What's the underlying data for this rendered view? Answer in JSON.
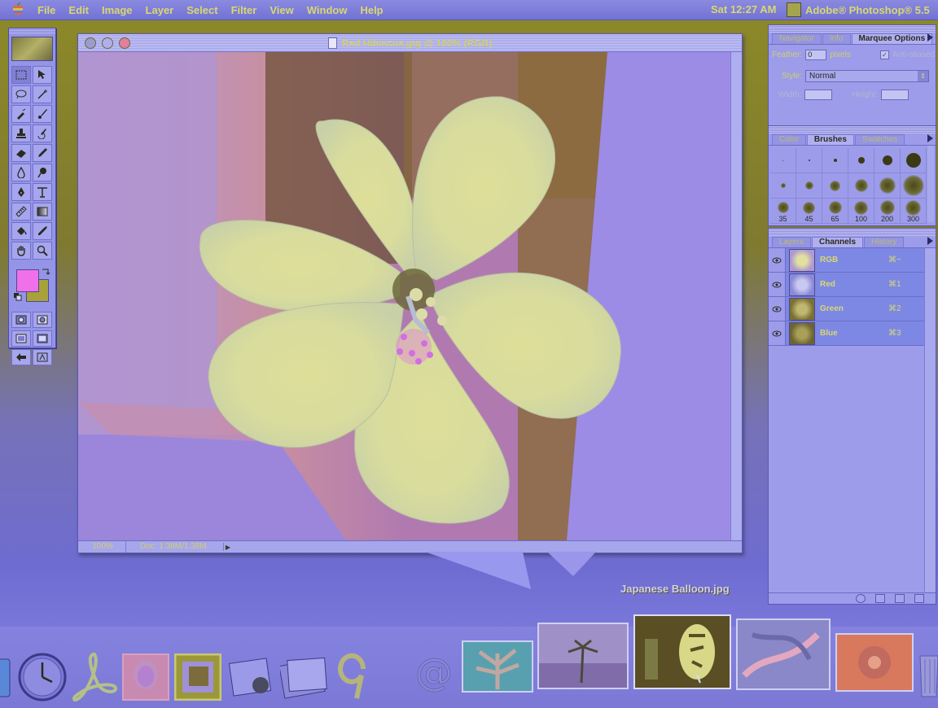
{
  "menubar": {
    "items": [
      "File",
      "Edit",
      "Image",
      "Layer",
      "Select",
      "Filter",
      "View",
      "Window",
      "Help"
    ],
    "clock": "Sat 12:27 AM",
    "app_name": "Adobe® Photoshop® 5.5"
  },
  "document": {
    "title": "Red Hibiscus.jpg @ 100% (RGB)",
    "zoom": "100%",
    "doc_info": "Doc: 1.38M/1.38M"
  },
  "palettes": {
    "marquee": {
      "tabs": [
        "Navigator",
        "Info",
        "Marquee Options"
      ],
      "feather_label": "Feather:",
      "feather_value": "0",
      "feather_unit": "pixels",
      "anti_aliased": "Anti-aliased",
      "style_label": "Style:",
      "style_value": "Normal",
      "width_label": "Width:",
      "height_label": "Height:"
    },
    "brushes": {
      "tabs": [
        "Color",
        "Brushes",
        "Swatches"
      ],
      "sizes": [
        "35",
        "45",
        "65",
        "100",
        "200",
        "300"
      ]
    },
    "channels": {
      "tabs": [
        "Layers",
        "Channels",
        "History"
      ],
      "rows": [
        {
          "name": "RGB",
          "shortcut": "⌘~"
        },
        {
          "name": "Red",
          "shortcut": "⌘1"
        },
        {
          "name": "Green",
          "shortcut": "⌘2"
        },
        {
          "name": "Blue",
          "shortcut": "⌘3"
        }
      ]
    }
  },
  "dock": {
    "caption": "Japanese Balloon.jpg"
  },
  "colors": {
    "foreground": "#f070ec",
    "background": "#a8a23a",
    "menu_text": "#d8d870"
  }
}
